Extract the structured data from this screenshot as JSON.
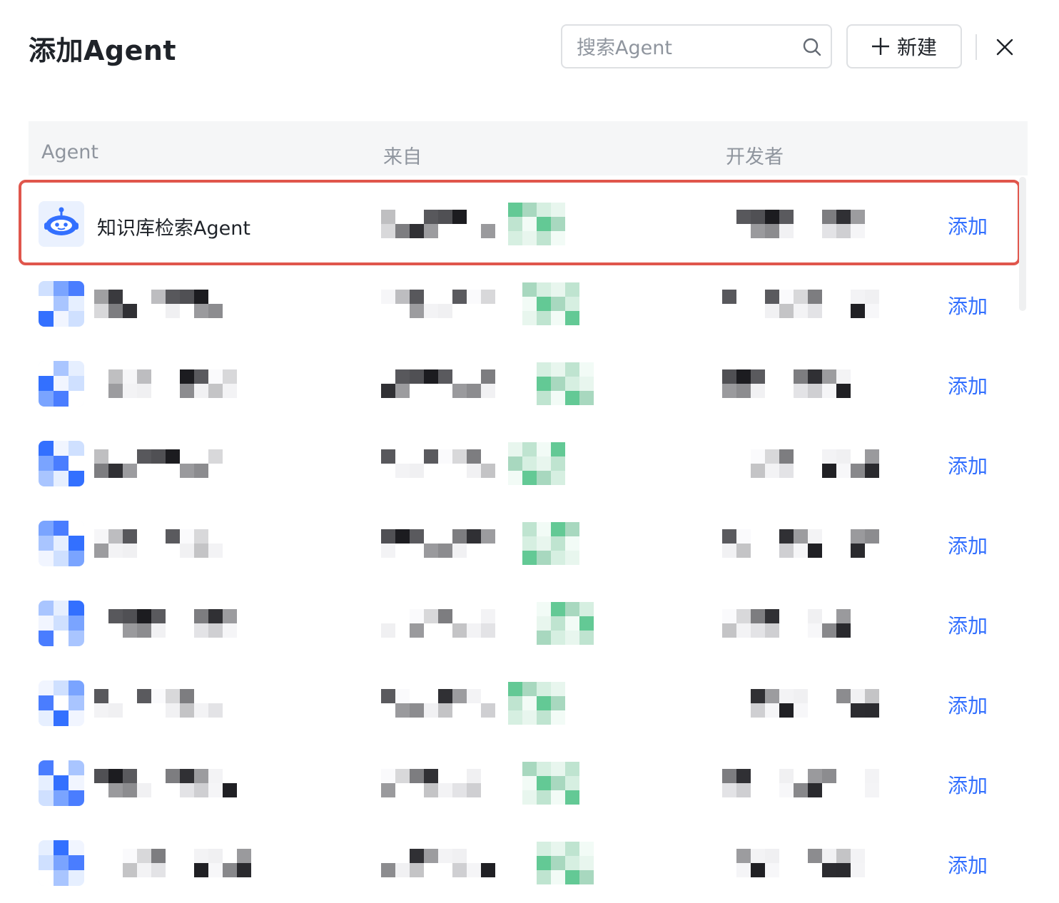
{
  "dialog": {
    "title": "添加Agent",
    "search_placeholder": "搜索Agent",
    "new_label": "新建"
  },
  "table": {
    "columns": [
      "Agent",
      "来自",
      "开发者"
    ],
    "add_label": "添加",
    "rows": [
      {
        "name": "知识库检索Agent",
        "avatar": "robot-icon",
        "selected": true
      },
      {
        "name": "",
        "avatar": "pixelated-avatar"
      },
      {
        "name": "",
        "avatar": "pixelated-avatar"
      },
      {
        "name": "",
        "avatar": "pixelated-avatar"
      },
      {
        "name": "",
        "avatar": "pixelated-avatar"
      },
      {
        "name": "",
        "avatar": "pixelated-avatar"
      },
      {
        "name": "",
        "avatar": "pixelated-avatar"
      },
      {
        "name": "",
        "avatar": "pixelated-avatar"
      },
      {
        "name": "",
        "avatar": "pixelated-avatar"
      }
    ]
  },
  "colors": {
    "accent": "#3370ff",
    "highlight_border": "#e0564c",
    "header_bg": "#f5f6f7"
  }
}
